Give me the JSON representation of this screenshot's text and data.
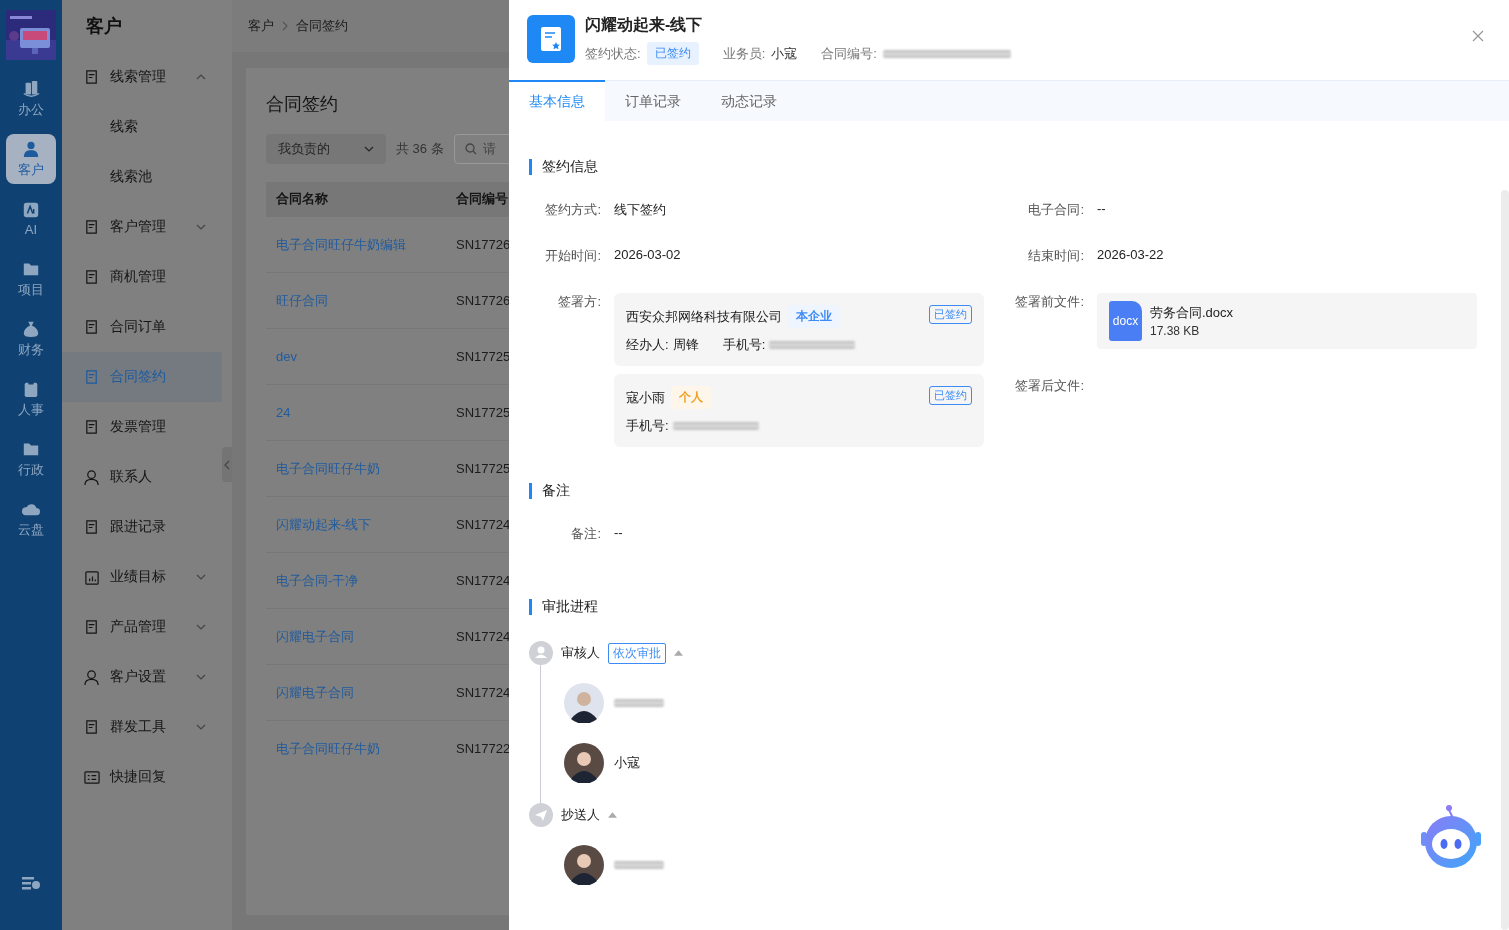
{
  "sidebar": {
    "items": [
      {
        "label": "办公",
        "selected": false
      },
      {
        "label": "客户",
        "selected": true
      },
      {
        "label": "AI",
        "selected": false
      },
      {
        "label": "项目",
        "selected": false
      },
      {
        "label": "财务",
        "selected": false
      },
      {
        "label": "人事",
        "selected": false
      },
      {
        "label": "行政",
        "selected": false
      },
      {
        "label": "云盘",
        "selected": false
      }
    ]
  },
  "menu": {
    "title": "客户",
    "items": [
      {
        "label": "线索管理",
        "kind": "group",
        "expanded": true,
        "selected": false,
        "children": [
          {
            "label": "线索",
            "selected": false
          },
          {
            "label": "线索池",
            "selected": false
          }
        ]
      },
      {
        "label": "客户管理",
        "kind": "group",
        "expanded": false,
        "selected": false
      },
      {
        "label": "商机管理",
        "kind": "link",
        "selected": false
      },
      {
        "label": "合同订单",
        "kind": "link",
        "selected": false
      },
      {
        "label": "合同签约",
        "kind": "link",
        "selected": true
      },
      {
        "label": "发票管理",
        "kind": "link",
        "selected": false
      },
      {
        "label": "联系人",
        "kind": "link",
        "selected": false
      },
      {
        "label": "跟进记录",
        "kind": "link",
        "selected": false
      },
      {
        "label": "业绩目标",
        "kind": "group",
        "expanded": false,
        "selected": false
      },
      {
        "label": "产品管理",
        "kind": "group",
        "expanded": false,
        "selected": false
      },
      {
        "label": "客户设置",
        "kind": "group",
        "expanded": false,
        "selected": false
      },
      {
        "label": "群发工具",
        "kind": "group",
        "expanded": false,
        "selected": false
      },
      {
        "label": "快捷回复",
        "kind": "link",
        "selected": false
      }
    ]
  },
  "breadcrumb": [
    "客户",
    "合同签约"
  ],
  "list": {
    "title": "合同签约",
    "filter": "我负责的",
    "count": "共 36 条",
    "search_placeholder": "请",
    "columns": [
      "合同名称",
      "合同编号"
    ],
    "rows": [
      [
        "电子合同旺仔牛奶编辑",
        "SN17726"
      ],
      [
        "旺仔合同",
        "SN17726"
      ],
      [
        "dev",
        "SN17725"
      ],
      [
        "24",
        "SN17725"
      ],
      [
        "电子合同旺仔牛奶",
        "SN17725"
      ],
      [
        "闪耀动起来-线下",
        "SN17724"
      ],
      [
        "电子合同-干净",
        "SN17724"
      ],
      [
        "闪耀电子合同",
        "SN17724"
      ],
      [
        "闪耀电子合同",
        "SN17724"
      ],
      [
        "电子合同旺仔牛奶",
        "SN17722"
      ]
    ]
  },
  "drawer": {
    "title": "闪耀动起来-线下",
    "meta": [
      {
        "label": "签约状态:",
        "kind": "tag",
        "value": "已签约"
      },
      {
        "label": "业务员:",
        "kind": "text",
        "value": "小寇"
      },
      {
        "label": "合同编号:",
        "kind": "redacted"
      }
    ],
    "tabs": [
      {
        "label": "基本信息",
        "selected": true
      },
      {
        "label": "订单记录",
        "selected": false
      },
      {
        "label": "动态记录",
        "selected": false
      }
    ],
    "sign_section": "签约信息",
    "fields": [
      [
        {
          "label": "签约方式:",
          "value": "线下签约"
        },
        {
          "label": "电子合同:",
          "value": "--"
        }
      ],
      [
        {
          "label": "开始时间:",
          "value": "2026-03-02"
        },
        {
          "label": "结束时间:",
          "value": "2026-03-22"
        }
      ]
    ],
    "parties_label": "签署方:",
    "parties": [
      {
        "name": "西安众邦网络科技有限公司",
        "tag": "本企业",
        "color": "#3d8bf5",
        "status": "已签约",
        "lines": [
          {
            "label": "经办人:",
            "kind": "text",
            "value": "周锋"
          },
          {
            "label": "手机号:",
            "kind": "redacted"
          }
        ]
      },
      {
        "name": "寇小雨",
        "tag": "个人",
        "color": "#f0a020",
        "status": "已签约",
        "lines": [
          {
            "label": "手机号:",
            "kind": "redacted"
          }
        ]
      }
    ],
    "files_before_label": "签署前文件:",
    "files_before": [
      {
        "badge": "docx",
        "name": "劳务合同.docx",
        "size": "17.38 KB"
      }
    ],
    "files_after_label": "签署后文件:",
    "remark_section": "备注",
    "remark": {
      "label": "备注:",
      "value": "--"
    },
    "approval_section": "审批进程",
    "approval": [
      {
        "kind": "reviewer",
        "label": "审核人",
        "mode": "依次审批",
        "expanded": true,
        "people": [
          {
            "redacted": true
          },
          {
            "redacted": false,
            "name": "小寇"
          }
        ]
      },
      {
        "kind": "cc",
        "label": "抄送人",
        "expanded": true,
        "people": [
          {
            "redacted": true
          }
        ]
      }
    ]
  }
}
